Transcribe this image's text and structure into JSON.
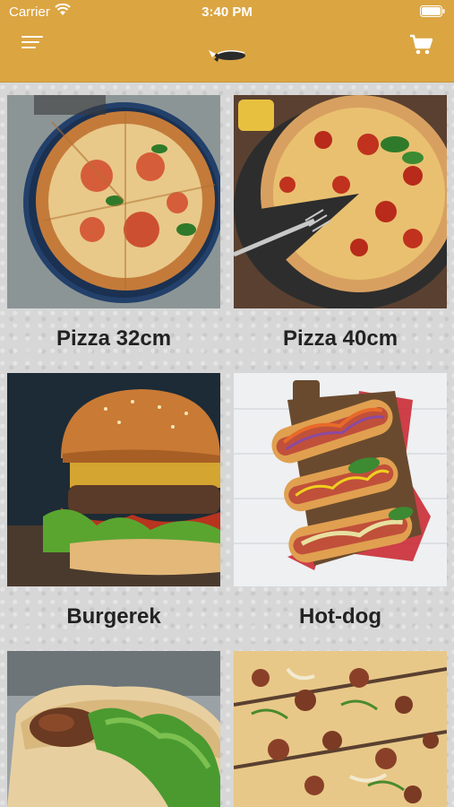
{
  "status_bar": {
    "carrier": "Carrier",
    "time": "3:40 PM"
  },
  "header": {
    "menu_icon": "hamburger-menu-icon",
    "cart_icon": "shopping-cart-icon",
    "accent": "#dba542"
  },
  "categories": [
    {
      "label": "Pizza 32cm"
    },
    {
      "label": "Pizza 40cm"
    },
    {
      "label": "Burgerek"
    },
    {
      "label": "Hot-dog"
    },
    {
      "label": ""
    },
    {
      "label": ""
    }
  ]
}
